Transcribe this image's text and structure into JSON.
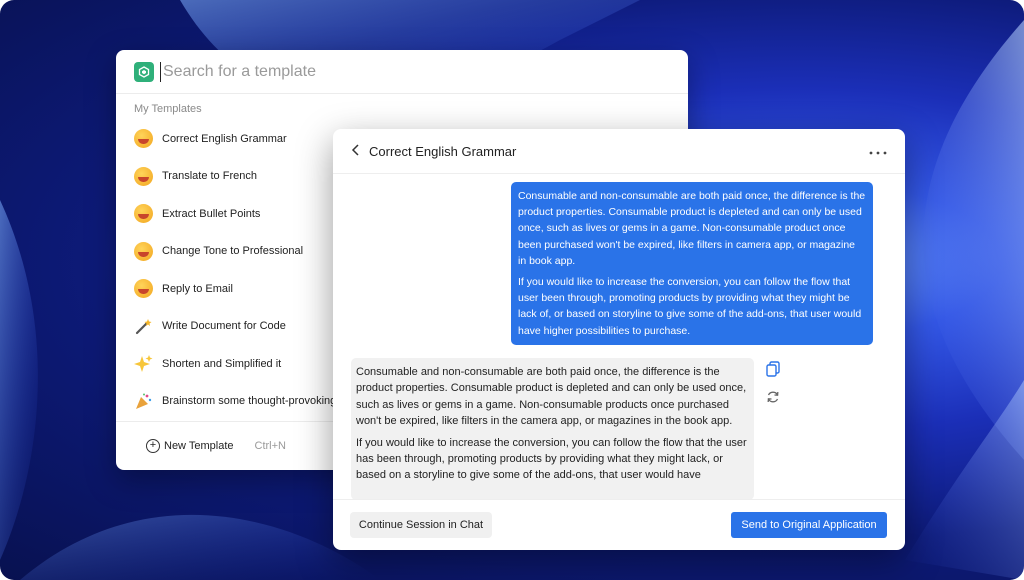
{
  "picker": {
    "search_placeholder": "Search for a template",
    "section_label": "My Templates",
    "templates": [
      {
        "label": "Correct English Grammar",
        "icon": "grinning-face-icon"
      },
      {
        "label": "Translate to French",
        "icon": "heart-eyes-face-icon"
      },
      {
        "label": "Extract Bullet Points",
        "icon": "zany-face-icon"
      },
      {
        "label": "Change Tone to Professional",
        "icon": "grimacing-face-icon"
      },
      {
        "label": "Reply to Email",
        "icon": "kissing-face-icon"
      },
      {
        "label": "Write Document for Code",
        "icon": "magic-wand-icon"
      },
      {
        "label": "Shorten and Simplified it",
        "icon": "sparkles-icon"
      },
      {
        "label": "Brainstorm some thought-provoking",
        "icon": "party-popper-icon"
      }
    ],
    "new_template_label": "New Template",
    "new_template_shortcut": "Ctrl+N"
  },
  "chat": {
    "title": "Correct English Grammar",
    "user_message": [
      "Consumable and non-consumable are both paid once, the difference is the product properties. Consumable product is depleted and can only be used once, such as lives or gems in a game. Non-consumable product once been purchased won't be expired, like filters in camera app, or magazine in book app.",
      "If you would like to increase the conversion, you can follow the flow that user been through, promoting products by providing what they might be lack of, or based on storyline to give some of the add-ons, that user would have higher possibilities to purchase."
    ],
    "ai_message": [
      "Consumable and non-consumable are both paid once, the difference is the product properties. Consumable product is depleted and can only be used once, such as lives or gems in a game. Non-consumable products once purchased won't be expired, like filters in the camera app, or magazines in the book app.",
      "If you would like to increase the conversion, you can follow the flow that the user has been through, promoting products by providing what they might lack, or based on a storyline to give some of the add-ons, that user would have"
    ],
    "continue_label": "Continue Session in Chat",
    "send_label": "Send to Original Application"
  },
  "colors": {
    "accent": "#2a73e8",
    "logo_green": "#2fb07a"
  }
}
